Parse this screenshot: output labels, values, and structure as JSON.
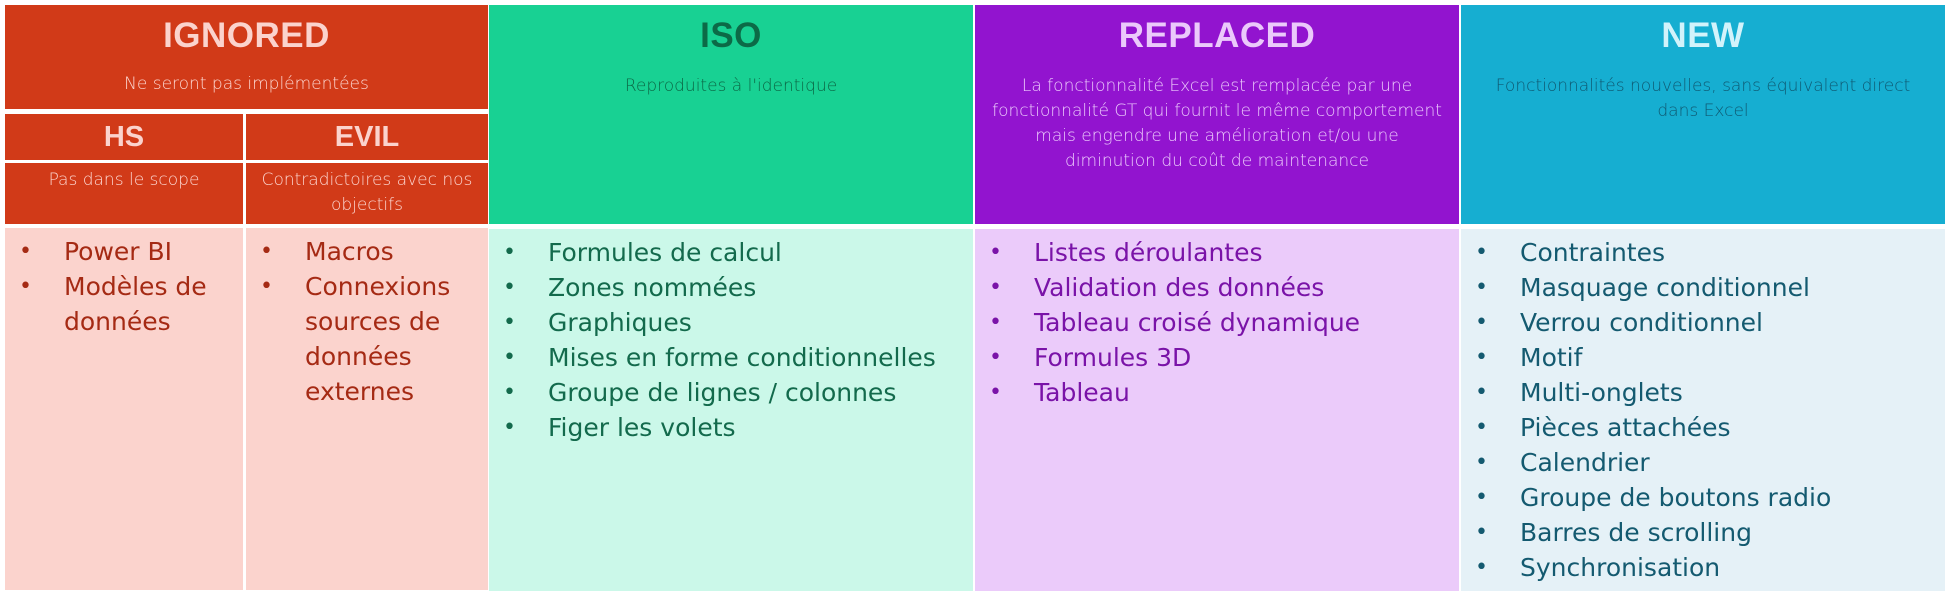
{
  "columns": {
    "ignored": {
      "title": "IGNORED",
      "subtitle": "Ne seront pas implémentées",
      "header_color": "#d13a18",
      "body_color": "#fbd3cd",
      "subcategories": [
        {
          "title": "HS",
          "subtitle": "Pas dans le scope",
          "items": [
            "Power BI",
            "Modèles de données"
          ]
        },
        {
          "title": "EVIL",
          "subtitle": "Contradictoires avec nos objectifs",
          "items": [
            "Macros",
            "Connexions sources de données externes"
          ]
        }
      ]
    },
    "iso": {
      "title": "ISO",
      "subtitle": "Reproduites à l'identique",
      "header_color": "#18d193",
      "body_color": "#cbf8e9",
      "items": [
        "Formules de calcul",
        "Zones nommées",
        "Graphiques",
        "Mises en forme conditionnelles",
        "Groupe de lignes / colonnes",
        "Figer les volets"
      ]
    },
    "replaced": {
      "title": "REPLACED",
      "subtitle": "La fonctionnalité Excel est remplacée par une fonctionnalité GT qui fournit le même comportement mais engendre une amélioration et/ou une diminution du coût de maintenance",
      "header_color": "#9214cf",
      "body_color": "#ebcbfa",
      "items": [
        "Listes déroulantes",
        "Validation des données",
        "Tableau croisé dynamique",
        "Formules 3D",
        "Tableau"
      ]
    },
    "new": {
      "title": "NEW",
      "subtitle": "Fonctionnalités nouvelles, sans équivalent direct dans Excel",
      "header_color": "#16aed1",
      "body_color": "#e5f1f7",
      "items": [
        "Contraintes",
        "Masquage conditionnel",
        "Verrou conditionnel",
        "Motif",
        "Multi-onglets",
        "Pièces attachées",
        "Calendrier",
        "Groupe de boutons radio",
        "Barres de scrolling",
        "Synchronisation"
      ]
    }
  },
  "bullet_glyph": "•"
}
